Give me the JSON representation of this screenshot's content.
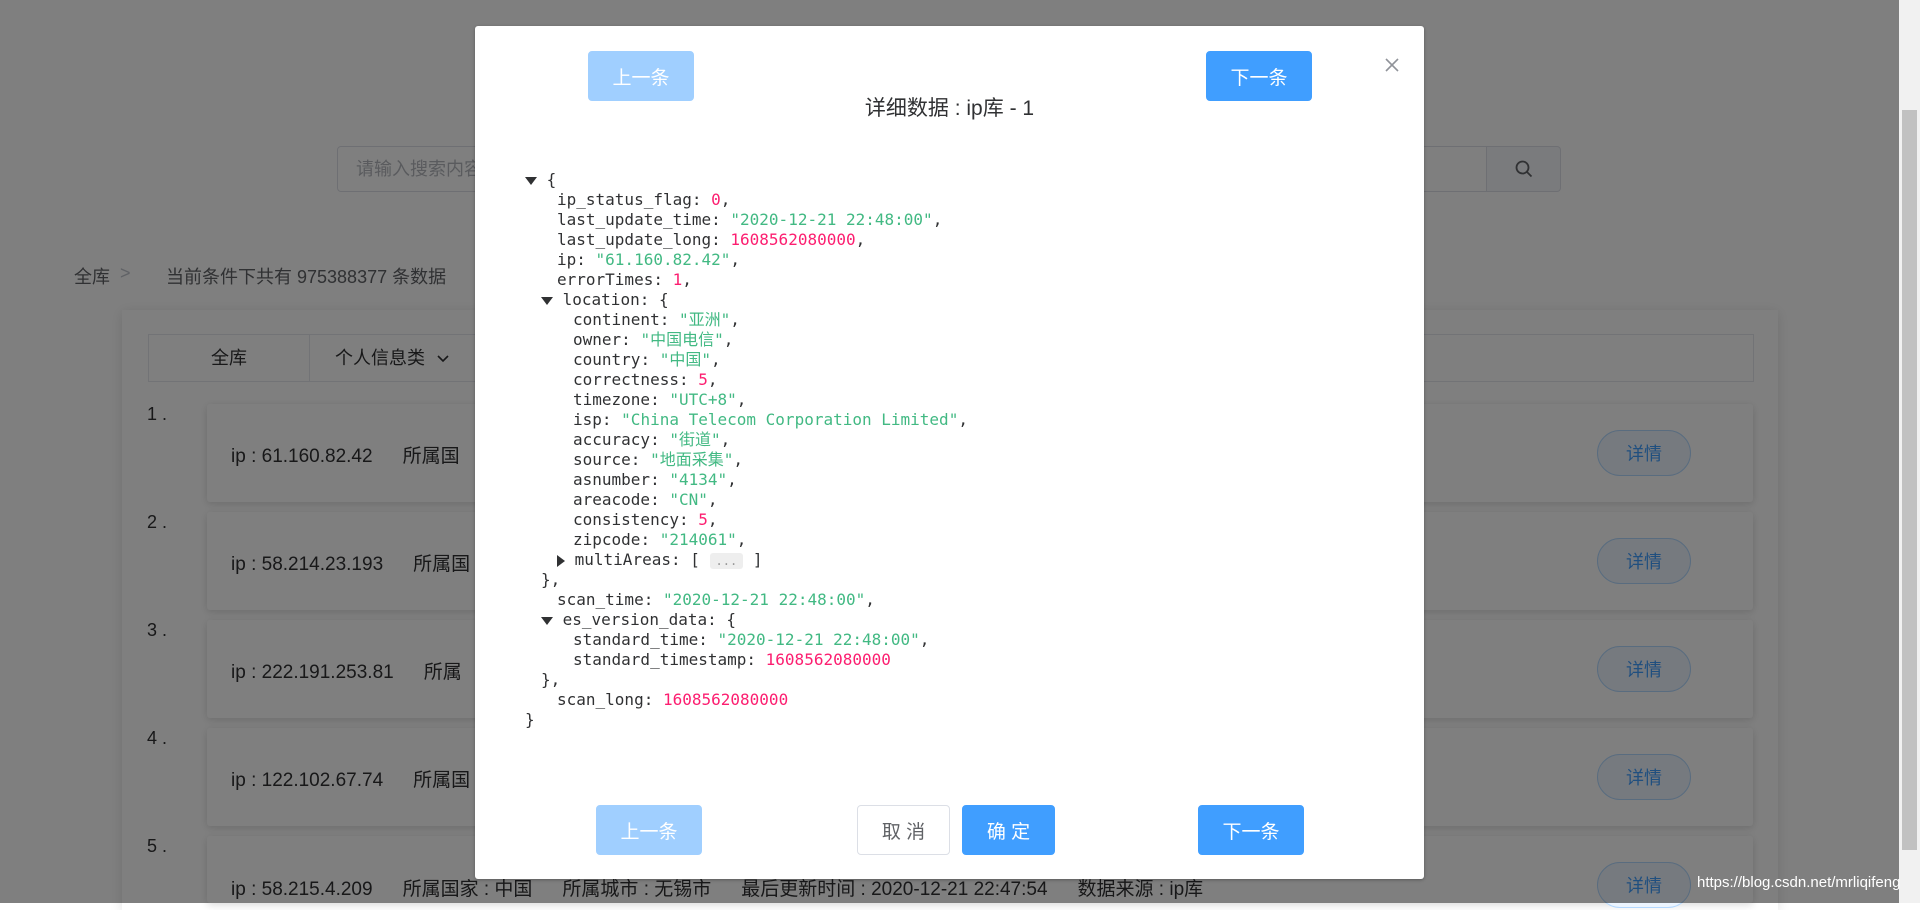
{
  "search": {
    "placeholder": "请输入搜索内容"
  },
  "breadcrumb": {
    "root": "全库",
    "separator": ">",
    "summary": "当前条件下共有 975388377 条数据"
  },
  "tabs": [
    {
      "label": "全库"
    },
    {
      "label": "个人信息类"
    }
  ],
  "results": [
    {
      "index": "1 .",
      "ip": "ip : 61.160.82.42",
      "country": "所属国",
      "detail": "详情"
    },
    {
      "index": "2 .",
      "ip": "ip : 58.214.23.193",
      "country": "所属国",
      "detail": "详情"
    },
    {
      "index": "3 .",
      "ip": "ip : 222.191.253.81",
      "country": "所属",
      "detail": "详情"
    },
    {
      "index": "4 .",
      "ip": "ip : 122.102.67.74",
      "country": "所属国",
      "detail": "详情"
    },
    {
      "index": "5 .",
      "ip": "ip : 58.215.4.209",
      "country": "所属国家 : 中国",
      "city": "所属城市 : 无锡市",
      "updated": "最后更新时间 : 2020-12-21 22:47:54",
      "source": "数据来源 : ip库",
      "detail": "详情"
    }
  ],
  "watermark": "https://blog.csdn.net/mrliqifeng",
  "dialog": {
    "title": "详细数据 : ip库 - 1",
    "prev_label": "上一条",
    "next_label": "下一条",
    "cancel_label": "取 消",
    "confirm_label": "确 定",
    "close_icon": "close-icon"
  },
  "json_lines": {
    "l0": "{",
    "ip_status_flag_key": "ip_status_flag",
    "ip_status_flag_val": "0",
    "last_update_time_key": "last_update_time",
    "last_update_time_val": "\"2020-12-21 22:48:00\"",
    "last_update_long_key": "last_update_long",
    "last_update_long_val": "1608562080000",
    "ip_key": "ip",
    "ip_val": "\"61.160.82.42\"",
    "errorTimes_key": "errorTimes",
    "errorTimes_val": "1",
    "location_key": "location",
    "continent_key": "continent",
    "continent_val": "\"亚洲\"",
    "owner_key": "owner",
    "owner_val": "\"中国电信\"",
    "country_key": "country",
    "country_val": "\"中国\"",
    "correctness_key": "correctness",
    "correctness_val": "5",
    "timezone_key": "timezone",
    "timezone_val": "\"UTC+8\"",
    "isp_key": "isp",
    "isp_val": "\"China Telecom Corporation Limited\"",
    "accuracy_key": "accuracy",
    "accuracy_val": "\"街道\"",
    "source_key": "source",
    "source_val": "\"地面采集\"",
    "asnumber_key": "asnumber",
    "asnumber_val": "\"4134\"",
    "areacode_key": "areacode",
    "areacode_val": "\"CN\"",
    "consistency_key": "consistency",
    "consistency_val": "5",
    "zipcode_key": "zipcode",
    "zipcode_val": "\"214061\"",
    "multiAreas_key": "multiAreas",
    "ellipsis": "...",
    "scan_time_key": "scan_time",
    "scan_time_val": "\"2020-12-21 22:48:00\"",
    "es_version_data_key": "es_version_data",
    "standard_time_key": "standard_time",
    "standard_time_val": "\"2020-12-21 22:48:00\"",
    "standard_timestamp_key": "standard_timestamp",
    "standard_timestamp_val": "1608562080000",
    "scan_long_key": "scan_long",
    "scan_long_val": "1608562080000"
  }
}
